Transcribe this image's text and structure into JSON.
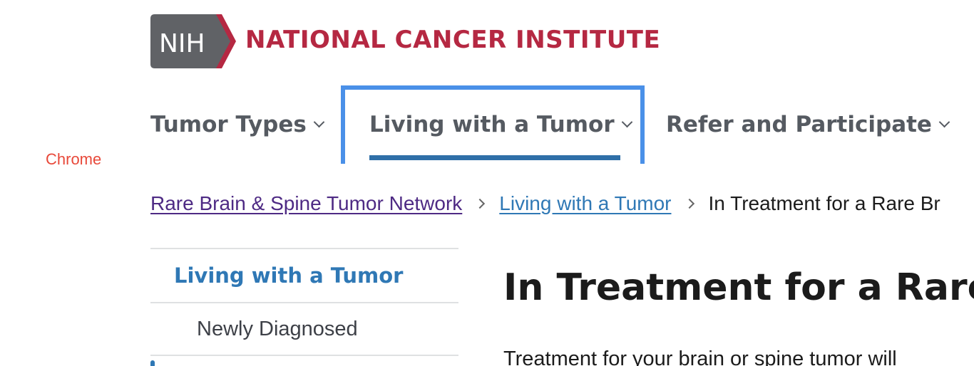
{
  "header": {
    "logo_text": "NIH",
    "site_title": "NATIONAL CANCER INSTITUTE"
  },
  "overlay": {
    "browser_label": "Chrome"
  },
  "nav": {
    "items": [
      {
        "label": "Tumor Types",
        "active": false
      },
      {
        "label": "Living with a Tumor",
        "active": true
      },
      {
        "label": "Refer and Participate",
        "active": false
      }
    ]
  },
  "breadcrumb": {
    "items": [
      {
        "label": "Rare Brain & Spine Tumor Network"
      },
      {
        "label": "Living with a Tumor"
      },
      {
        "label": "In Treatment for a Rare Br"
      }
    ]
  },
  "sidenav": {
    "heading": "Living with a Tumor",
    "items": [
      {
        "label": "Newly Diagnosed"
      }
    ]
  },
  "main": {
    "heading": "In Treatment for a Rare",
    "intro": "Treatment for your brain or spine tumor will"
  },
  "colors": {
    "brand_red": "#b52842",
    "logo_gray": "#606266",
    "focus_blue": "#4a90e8",
    "link_blue": "#2f78b5",
    "visited_purple": "#4e2a84",
    "chrome_label": "#e8493a"
  }
}
